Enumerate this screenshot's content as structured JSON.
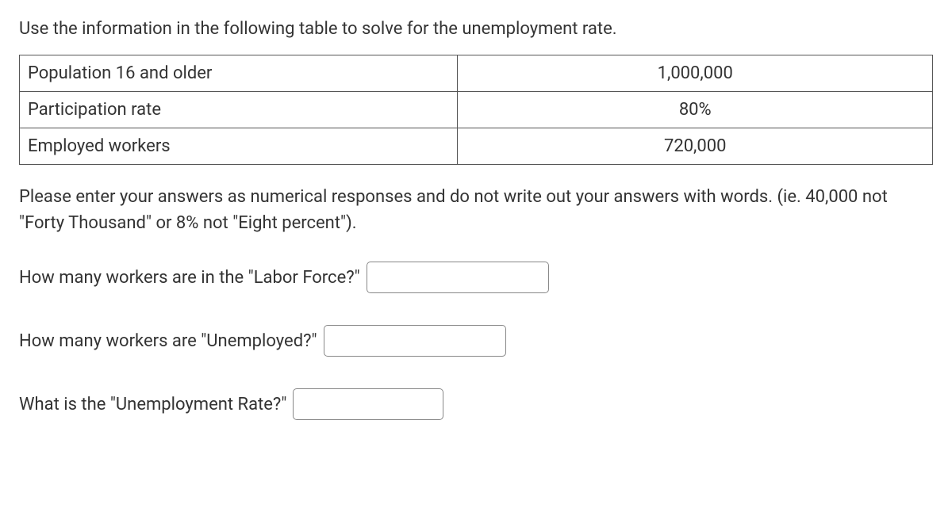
{
  "intro_text": "Use the information in the following table to solve for the unemployment rate.",
  "table": {
    "rows": [
      {
        "label": "Population 16 and older",
        "value": "1,000,000"
      },
      {
        "label": "Participation rate",
        "value": "80%"
      },
      {
        "label": "Employed workers",
        "value": "720,000"
      }
    ]
  },
  "instructions_text": "Please enter your answers as numerical responses and do not write out your answers with words. (ie. 40,000 not \"Forty Thousand\" or 8% not \"Eight percent\").",
  "questions": {
    "q1": {
      "text": "How many workers are in the \"Labor Force?\"",
      "value": ""
    },
    "q2": {
      "text": "How many workers are \"Unemployed?\"",
      "value": ""
    },
    "q3": {
      "text": "What is the \"Unemployment Rate?\"",
      "value": ""
    }
  }
}
